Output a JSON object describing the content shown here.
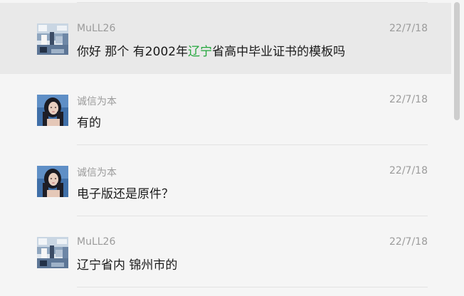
{
  "messages": [
    {
      "sender": "MuLL26",
      "time": "22/7/18",
      "text_before": "你好 那个 有2002年",
      "text_highlight": "辽宁",
      "text_after": "省高中毕业证书的模板吗",
      "avatar": "landscape-avatar",
      "highlight_color": "#21a53a"
    },
    {
      "sender": "诚信为本",
      "time": "22/7/18",
      "text": "有的",
      "avatar": "woman-portrait-avatar"
    },
    {
      "sender": "诚信为本",
      "time": "22/7/18",
      "text": "电子版还是原件？",
      "avatar": "woman-portrait-avatar"
    },
    {
      "sender": "MuLL26",
      "time": "22/7/18",
      "text": "辽宁省内 锦州市的",
      "avatar": "landscape-avatar"
    }
  ]
}
